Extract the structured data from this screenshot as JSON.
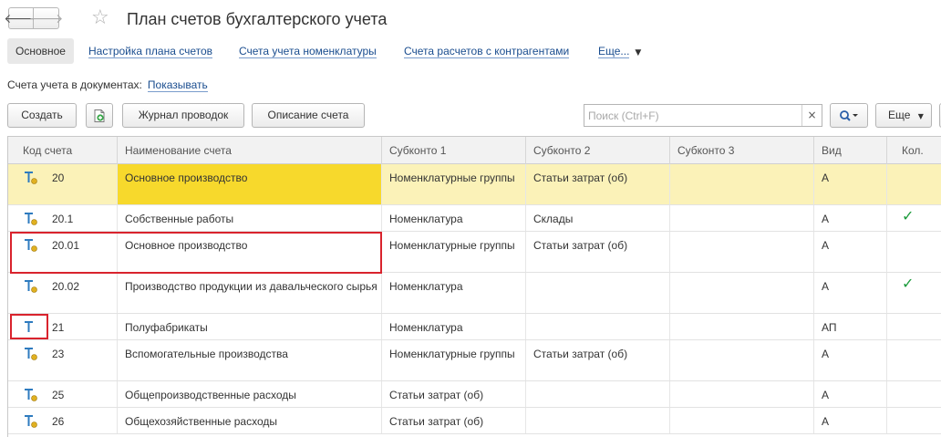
{
  "header": {
    "title": "План счетов бухгалтерского учета",
    "back_glyph": "🡐",
    "forward_glyph": "🡒",
    "star_glyph": "☆"
  },
  "tabs": [
    {
      "label": "Основное",
      "active": true
    },
    {
      "label": "Настройка плана счетов",
      "active": false
    },
    {
      "label": "Счета учета номенклатуры",
      "active": false
    },
    {
      "label": "Счета расчетов с контрагентами",
      "active": false
    },
    {
      "label": "Еще...",
      "active": false
    }
  ],
  "doc_accounts": {
    "label": "Счета учета в документах:",
    "link": "Показывать"
  },
  "toolbar": {
    "create_label": "Создать",
    "journal_label": "Журнал проводок",
    "description_label": "Описание счета",
    "more_label": "Еще",
    "search_placeholder": "Поиск (Ctrl+F)",
    "clear_glyph": "×"
  },
  "table": {
    "columns": [
      "Код счета",
      "Наименование счета",
      "Субконто 1",
      "Субконто 2",
      "Субконто 3",
      "Вид",
      "Кол."
    ],
    "rows": [
      {
        "code": "20",
        "name": "Основное производство",
        "sub1": "Номенклатурные группы",
        "sub2": "Статьи затрат (об)",
        "sub3": "",
        "kind": "А",
        "qty": ""
      },
      {
        "code": "20.1",
        "name": "Собственные работы",
        "sub1": "Номенклатура",
        "sub2": "Склады",
        "sub3": "",
        "kind": "А",
        "qty": "✓"
      },
      {
        "code": "20.01",
        "name": "Основное производство",
        "sub1": "Номенклатурные группы",
        "sub2": "Статьи затрат (об)",
        "sub3": "",
        "kind": "А",
        "qty": ""
      },
      {
        "code": "20.02",
        "name": "Производство продукции из давальческого сырья",
        "sub1": "Номенклатура",
        "sub2": "",
        "sub3": "",
        "kind": "А",
        "qty": "✓"
      },
      {
        "code": "21",
        "name": "Полуфабрикаты",
        "sub1": "Номенклатура",
        "sub2": "",
        "sub3": "",
        "kind": "АП",
        "qty": ""
      },
      {
        "code": "23",
        "name": "Вспомогательные производства",
        "sub1": "Номенклатурные группы",
        "sub2": "Статьи затрат (об)",
        "sub3": "",
        "kind": "А",
        "qty": ""
      },
      {
        "code": "25",
        "name": "Общепроизводственные расходы",
        "sub1": "Статьи затрат (об)",
        "sub2": "",
        "sub3": "",
        "kind": "А",
        "qty": ""
      },
      {
        "code": "26",
        "name": "Общехозяйственные расходы",
        "sub1": "Статьи затрат (об)",
        "sub2": "",
        "sub3": "",
        "kind": "А",
        "qty": ""
      }
    ]
  },
  "colors": {
    "link": "#1a4d8f",
    "selected_row": "#fbf2b8",
    "selected_cell": "#f7d92c",
    "highlight_box": "#d9232d",
    "check": "#1c9b3c",
    "icon_t": "#2e7bbf",
    "icon_dot": "#e0b020"
  }
}
